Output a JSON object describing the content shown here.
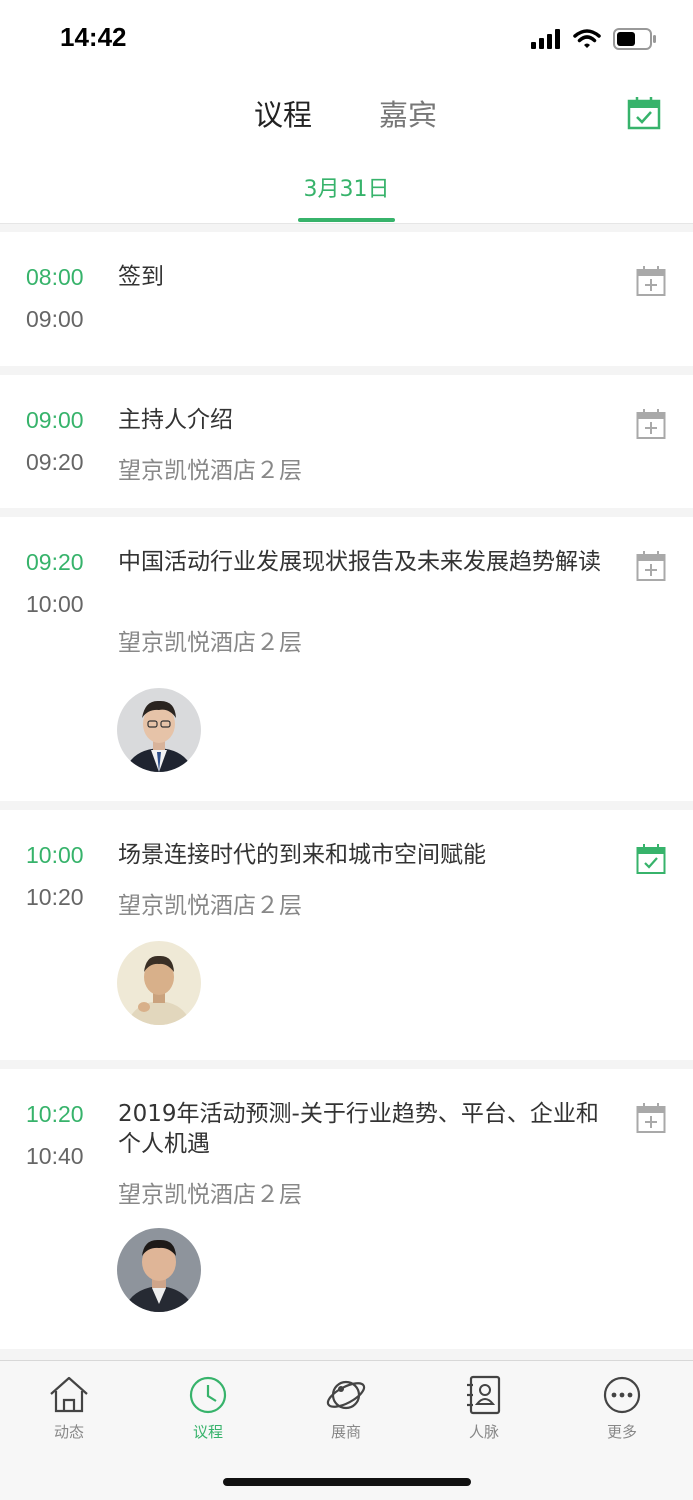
{
  "status": {
    "time": "14:42"
  },
  "header": {
    "tabs": [
      {
        "label": "议程",
        "active": true
      },
      {
        "label": "嘉宾",
        "active": false
      }
    ],
    "date": "3月31日",
    "calendar_icon": "calendar-check-icon"
  },
  "colors": {
    "accent": "#37b36b",
    "time_end": "#666666",
    "location": "#888888"
  },
  "agenda": [
    {
      "start": "08:00",
      "end": "09:00",
      "title": "签到",
      "location": "",
      "added": false,
      "has_speaker": false
    },
    {
      "start": "09:00",
      "end": "09:20",
      "title": "主持人介绍",
      "location": "望京凯悦酒店２层",
      "added": false,
      "has_speaker": false
    },
    {
      "start": "09:20",
      "end": "10:00",
      "title": "中国活动行业发展现状报告及未来发展趋势解读",
      "location": "望京凯悦酒店２层",
      "added": false,
      "has_speaker": true
    },
    {
      "start": "10:00",
      "end": "10:20",
      "title": "场景连接时代的到来和城市空间赋能",
      "location": "望京凯悦酒店２层",
      "added": true,
      "has_speaker": true
    },
    {
      "start": "10:20",
      "end": "10:40",
      "title": "2019年活动预测-关于行业趋势、平台、企业和个人机遇",
      "location": "望京凯悦酒店２层",
      "added": false,
      "has_speaker": true
    }
  ],
  "tabbar": {
    "items": [
      {
        "label": "动态",
        "icon": "home-icon",
        "active": false
      },
      {
        "label": "议程",
        "icon": "clock-icon",
        "active": true
      },
      {
        "label": "展商",
        "icon": "planet-icon",
        "active": false
      },
      {
        "label": "人脉",
        "icon": "contacts-book-icon",
        "active": false
      },
      {
        "label": "更多",
        "icon": "more-dots-icon",
        "active": false
      }
    ]
  }
}
